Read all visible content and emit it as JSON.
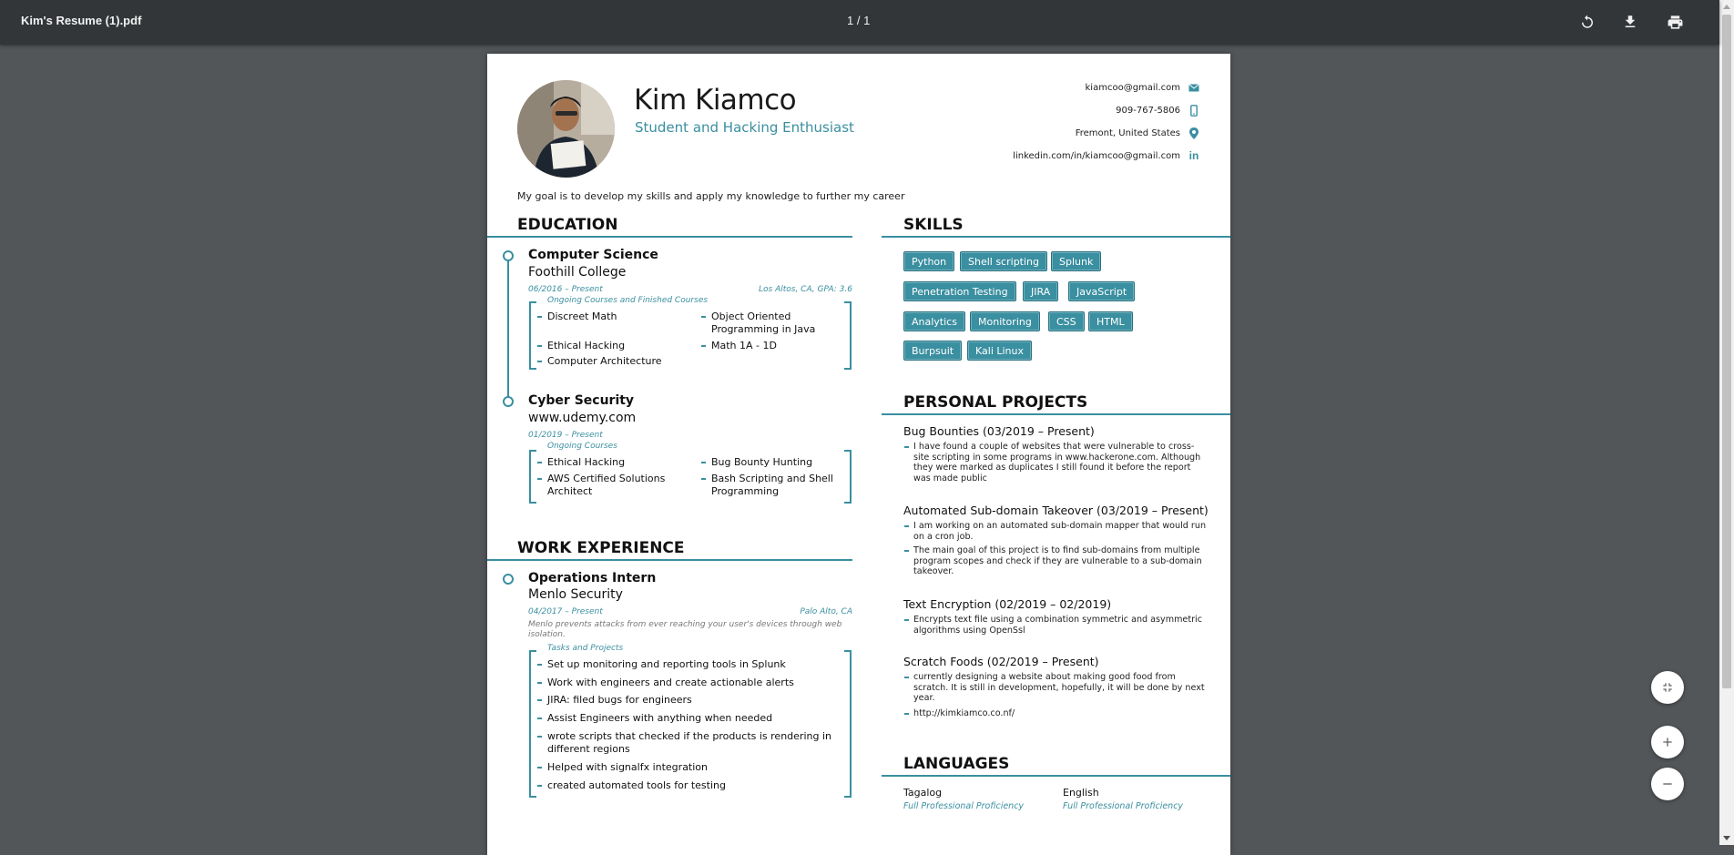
{
  "viewer": {
    "file_name": "Kim's Resume (1).pdf",
    "page_indicator": "1 / 1",
    "icons": [
      "rotate-icon",
      "download-icon",
      "print-icon",
      "fit-page-icon",
      "zoom-in-icon",
      "zoom-out-icon"
    ]
  },
  "header": {
    "name": "Kim Kiamco",
    "tagline": "Student and Hacking Enthusiast",
    "contacts": [
      {
        "text": "kiamcoo@gmail.com",
        "icon": "mail-icon"
      },
      {
        "text": "909-767-5806",
        "icon": "phone-icon"
      },
      {
        "text": "Fremont, United States",
        "icon": "location-pin-icon"
      },
      {
        "text": "linkedin.com/in/kiamcoo@gmail.com",
        "icon": "linkedin-icon"
      }
    ],
    "summary": "My goal is to develop my skills and apply my knowledge to further my career"
  },
  "education": {
    "heading": "EDUCATION",
    "entries": [
      {
        "title": "Computer Science",
        "org": "Foothill College",
        "dates": "06/2016 – Present",
        "location": "Los Altos, CA, GPA: 3.6",
        "list_label": "Ongoing Courses and Finished Courses",
        "items": [
          "Discreet Math",
          "Object Oriented Programming in Java",
          "Ethical Hacking",
          "Math 1A - 1D",
          "Computer Architecture"
        ]
      },
      {
        "title": "Cyber Security",
        "org": "www.udemy.com",
        "dates": "01/2019 – Present",
        "list_label": "Ongoing Courses",
        "items": [
          "Ethical Hacking",
          "Bug Bounty Hunting",
          "AWS Certified Solutions Architect",
          "Bash Scripting and Shell Programming"
        ]
      }
    ]
  },
  "work": {
    "heading": "WORK EXPERIENCE",
    "entries": [
      {
        "title": "Operations Intern",
        "org": "Menlo Security",
        "dates": "04/2017 – Present",
        "location": "Palo Alto, CA",
        "description": "Menlo prevents attacks from ever reaching your user's devices through web isolation.",
        "list_label": "Tasks and Projects",
        "items": [
          "Set up monitoring and reporting tools in Splunk",
          "Work with engineers and create actionable alerts",
          "JIRA: filed bugs for engineers",
          "Assist Engineers with anything when needed",
          "wrote scripts that checked if the products is rendering in different regions",
          "Helped with signalfx integration",
          "created automated tools for testing"
        ]
      }
    ]
  },
  "skills": {
    "heading": "SKILLS",
    "tags": [
      "Python",
      "Shell scripting",
      "Splunk",
      "Penetration Testing",
      "JIRA",
      "JavaScript",
      "Analytics",
      "Monitoring",
      "CSS",
      "HTML",
      "Burpsuit",
      "Kali Linux"
    ]
  },
  "projects": {
    "heading": "PERSONAL PROJECTS",
    "entries": [
      {
        "title": "Bug Bounties (03/2019 – Present)",
        "items": [
          "I have found a couple of websites that were vulnerable to cross-site scripting in some programs in www.hackerone.com. Although they were marked as duplicates I still found it before the report was made public"
        ]
      },
      {
        "title": "Automated Sub-domain Takeover (03/2019 – Present)",
        "items": [
          "I am working on an automated sub-domain mapper that would run on a cron job.",
          "The main goal of this project is to find sub-domains from multiple program scopes and check if they are vulnerable to a sub-domain takeover."
        ]
      },
      {
        "title": "Text Encryption (02/2019 – 02/2019)",
        "items": [
          "Encrypts text file using a combination symmetric and asymmetric algorithms using OpenSsl"
        ]
      },
      {
        "title": "Scratch Foods (02/2019 – Present)",
        "items": [
          "currently designing a website about making good food from scratch. It is still in development, hopefully, it will be done by next year.",
          "http://kimkiamco.co.nf/"
        ]
      }
    ]
  },
  "languages": {
    "heading": "LANGUAGES",
    "entries": [
      {
        "name": "Tagalog",
        "level": "Full Professional Proficiency"
      },
      {
        "name": "English",
        "level": "Full Professional Proficiency"
      }
    ]
  },
  "colors": {
    "accent": "#3a8fa0",
    "toolbar": "#323639",
    "viewer_bg": "#525659"
  }
}
